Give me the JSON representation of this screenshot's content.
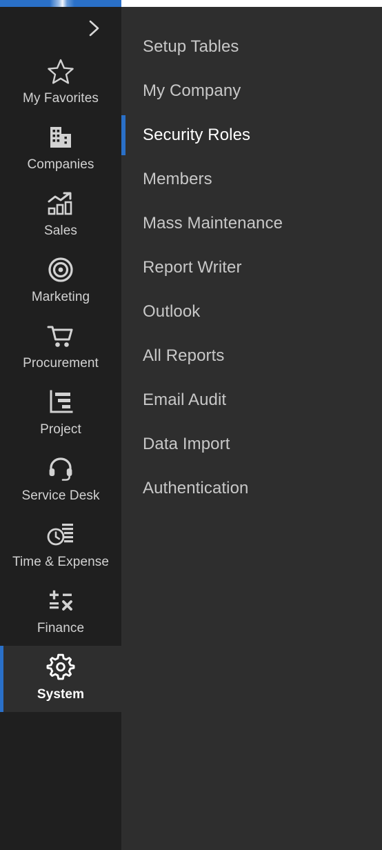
{
  "topbar": {
    "accent_color": "#2a70c8",
    "background": "#ffffff"
  },
  "sidebar": {
    "background": "#1f1f1f",
    "collapse_toggle": {
      "icon": "chevron-right-icon",
      "label": "Expand navigation"
    },
    "items": [
      {
        "label": "My Favorites",
        "icon": "star-icon",
        "active": false
      },
      {
        "label": "Companies",
        "icon": "buildings-icon",
        "active": false
      },
      {
        "label": "Sales",
        "icon": "trending-bars-icon",
        "active": false
      },
      {
        "label": "Marketing",
        "icon": "target-icon",
        "active": false
      },
      {
        "label": "Procurement",
        "icon": "cart-icon",
        "active": false
      },
      {
        "label": "Project",
        "icon": "gantt-chart-icon",
        "active": false
      },
      {
        "label": "Service Desk",
        "icon": "headset-icon",
        "active": false
      },
      {
        "label": "Time & Expense",
        "icon": "clock-list-icon",
        "active": false
      },
      {
        "label": "Finance",
        "icon": "calculator-icon",
        "active": false
      },
      {
        "label": "System",
        "icon": "gear-icon",
        "active": true
      }
    ]
  },
  "flyout": {
    "background": "#2e2e2e",
    "parent": "System",
    "active_accent": "#2a70c8",
    "items": [
      {
        "label": "Setup Tables",
        "active": false
      },
      {
        "label": "My Company",
        "active": false
      },
      {
        "label": "Security Roles",
        "active": true
      },
      {
        "label": "Members",
        "active": false
      },
      {
        "label": "Mass Maintenance",
        "active": false
      },
      {
        "label": "Report Writer",
        "active": false
      },
      {
        "label": "Outlook",
        "active": false
      },
      {
        "label": "All Reports",
        "active": false
      },
      {
        "label": "Email Audit",
        "active": false
      },
      {
        "label": "Data Import",
        "active": false
      },
      {
        "label": "Authentication",
        "active": false
      }
    ]
  }
}
